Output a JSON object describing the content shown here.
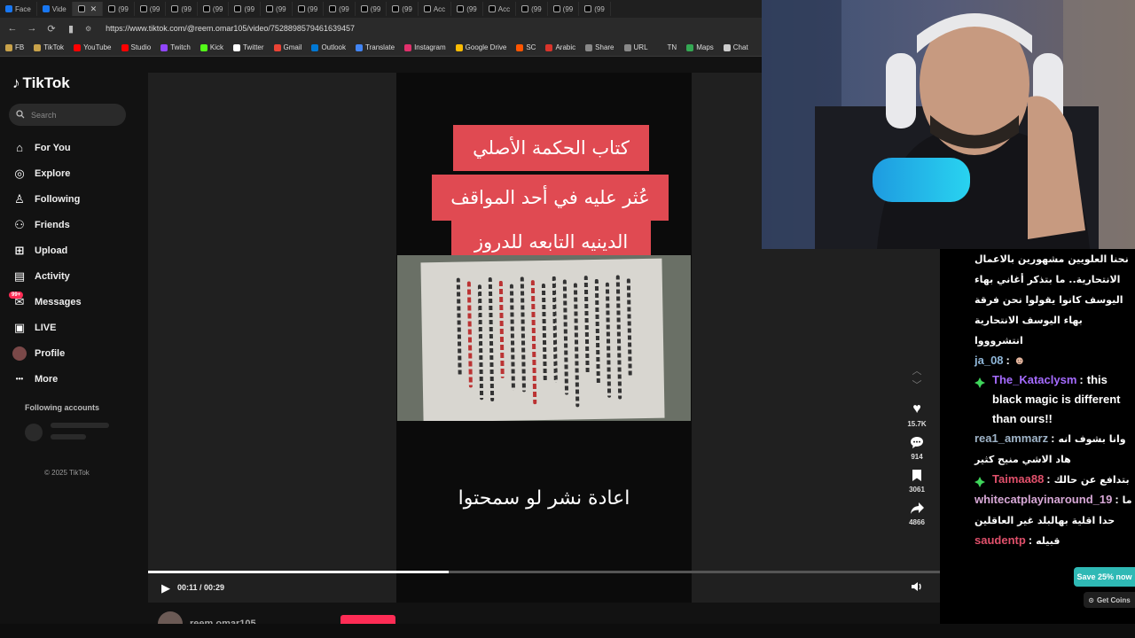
{
  "browser": {
    "tabs": [
      {
        "label": "Face",
        "icon": "facebook-icon"
      },
      {
        "label": "Vide",
        "icon": "facebook-icon"
      },
      {
        "label": "",
        "icon": "tiktok-icon",
        "active": true
      },
      {
        "label": "(99",
        "icon": "tiktok-icon"
      },
      {
        "label": "(99",
        "icon": "tiktok-icon"
      },
      {
        "label": "(99",
        "icon": "tiktok-icon"
      },
      {
        "label": "(99",
        "icon": "tiktok-icon"
      },
      {
        "label": "(99",
        "icon": "tiktok-icon"
      },
      {
        "label": "(99",
        "icon": "tiktok-icon"
      },
      {
        "label": "(99",
        "icon": "tiktok-icon"
      },
      {
        "label": "(99",
        "icon": "tiktok-icon"
      },
      {
        "label": "(99",
        "icon": "tiktok-icon"
      },
      {
        "label": "(99",
        "icon": "tiktok-icon"
      },
      {
        "label": "Acc",
        "icon": "tiktok-icon"
      },
      {
        "label": "(99",
        "icon": "tiktok-icon"
      },
      {
        "label": "Acc",
        "icon": "tiktok-icon"
      },
      {
        "label": "(99",
        "icon": "tiktok-icon"
      },
      {
        "label": "(99",
        "icon": "tiktok-icon"
      },
      {
        "label": "(99",
        "icon": "tiktok-icon"
      }
    ],
    "url": "https://www.tiktok.com/@reem.omar105/video/7528898579461639457",
    "bookmarks": [
      {
        "label": "FB",
        "color": "#c8a24a"
      },
      {
        "label": "TikTok",
        "color": "#c8a24a"
      },
      {
        "label": "YouTube",
        "color": "#ff0000"
      },
      {
        "label": "Studio",
        "color": "#ff0000"
      },
      {
        "label": "Twitch",
        "color": "#9146ff"
      },
      {
        "label": "Kick",
        "color": "#53fc18"
      },
      {
        "label": "Twitter",
        "color": "#ffffff"
      },
      {
        "label": "Gmail",
        "color": "#ea4335"
      },
      {
        "label": "Outlook",
        "color": "#0078d4"
      },
      {
        "label": "Translate",
        "color": "#4285f4"
      },
      {
        "label": "Instagram",
        "color": "#e1306c"
      },
      {
        "label": "Google Drive",
        "color": "#fbbc04"
      },
      {
        "label": "SC",
        "color": "#ff5500"
      },
      {
        "label": "Arabic",
        "color": "#d9342b"
      },
      {
        "label": "Share",
        "color": "#888888"
      },
      {
        "label": "URL",
        "color": "#888888"
      },
      {
        "label": "TN",
        "color": "#2a2a2a"
      },
      {
        "label": "Maps",
        "color": "#34a853"
      },
      {
        "label": "Chat",
        "color": "#cccccc"
      }
    ]
  },
  "tiktok": {
    "logo": "TikTok",
    "search_placeholder": "Search",
    "nav": [
      {
        "label": "For You",
        "icon": "home-icon"
      },
      {
        "label": "Explore",
        "icon": "compass-icon"
      },
      {
        "label": "Following",
        "icon": "following-icon"
      },
      {
        "label": "Friends",
        "icon": "friends-icon"
      },
      {
        "label": "Upload",
        "icon": "upload-icon"
      },
      {
        "label": "Activity",
        "icon": "activity-icon"
      },
      {
        "label": "Messages",
        "icon": "messages-icon",
        "badge": "99+"
      },
      {
        "label": "LIVE",
        "icon": "live-icon"
      },
      {
        "label": "Profile",
        "icon": "profile-icon"
      },
      {
        "label": "More",
        "icon": "more-icon"
      }
    ],
    "following_accounts": "Following accounts",
    "copyright": "© 2025 TikTok",
    "video": {
      "caption_lines": [
        "كتاب الحكمة الأصلي",
        "عُثر عليه في أحد  المواقف",
        "الدينيه  التابعه للدروز"
      ],
      "overlay_text": "اعادة نشر لو سمحتوا",
      "likes": "15.7K",
      "comments": "914",
      "saves": "3061",
      "shares": "4866",
      "time": "00:11 / 00:29",
      "progress": 0.38,
      "next_author": "reem.omar105"
    }
  },
  "chat": {
    "messages": [
      {
        "user": "",
        "color": "#ffffff",
        "text": "نحنا العلويين مشهورين بالاعمال الانتحارية.. ما بتذكر أغاني بهاء اليوسف كانوا يقولوا نحن فرقة بهاء اليوسف الانتحارية انتشروووا",
        "rtl": true,
        "gem": false
      },
      {
        "user": "ja_08",
        "color": "#8fb6d8",
        "text": "",
        "rtl": false,
        "gem": false,
        "emote": true
      },
      {
        "user": "The_Kataclysm",
        "color": "#a56bff",
        "text": "this black magic is different than ours!!",
        "rtl": false,
        "gem": true
      },
      {
        "user": "rea1_ammarz",
        "color": "#9fb4c8",
        "text": "وانا بشوف انه هاد الاشي منيح كثير",
        "rtl": true,
        "gem": false
      },
      {
        "user": "Taimaa88",
        "color": "#e0506b",
        "text": "بتدافع عن حالك",
        "rtl": true,
        "gem": true
      },
      {
        "user": "whitecatplayinaround_19",
        "color": "#d7a8d6",
        "text": "ما حدا اقلية بهالبلد غير العاقلين",
        "rtl": true,
        "gem": false
      },
      {
        "user": "saudentp",
        "color": "#e0506b",
        "text": "قبيله",
        "rtl": true,
        "gem": false
      }
    ],
    "save_button": "Save 25% now",
    "coins_button": "Get Coins"
  }
}
